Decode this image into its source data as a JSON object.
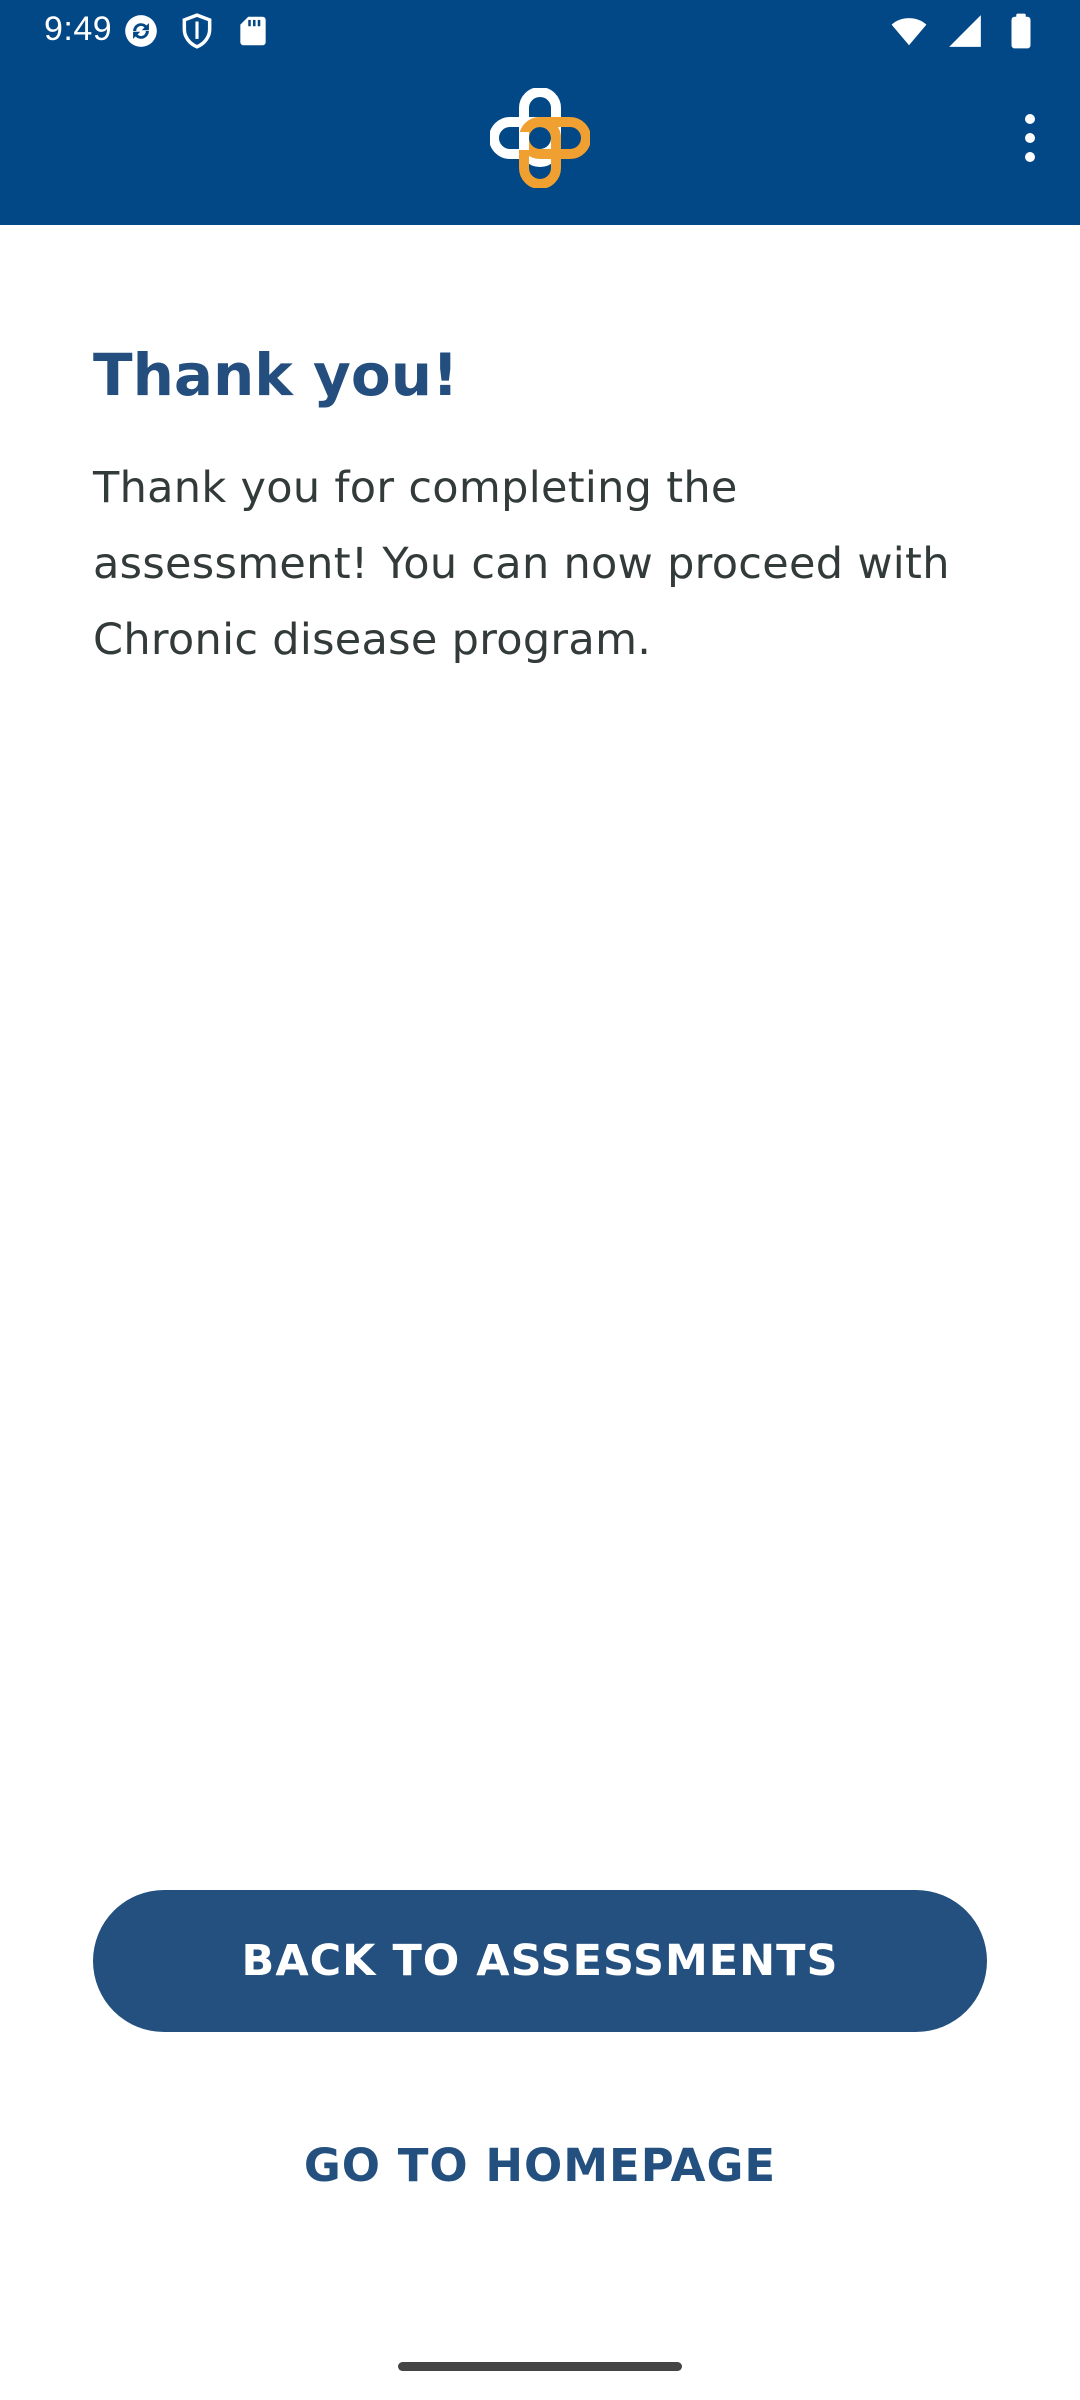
{
  "status_bar": {
    "time": "9:49",
    "left_icons": [
      "sync-icon",
      "shield-icon",
      "sd-card-icon"
    ],
    "right_icons": [
      "wifi-icon",
      "signal-icon",
      "battery-icon"
    ]
  },
  "app_bar": {
    "logo_icon": "cross-logo-icon",
    "menu_icon": "more-vert-icon",
    "colors": {
      "background": "#024886",
      "logo_primary": "#ffffff",
      "logo_accent": "#f0a030"
    }
  },
  "main": {
    "title": "Thank you!",
    "message": "Thank you for completing the assessment! You can now proceed with Chronic disease program."
  },
  "actions": {
    "primary_label": "BACK TO ASSESSMENTS",
    "secondary_label": "GO TO HOMEPAGE"
  },
  "colors": {
    "accent": "#23507f",
    "title": "#234e7e",
    "body_text": "#333a3a"
  }
}
